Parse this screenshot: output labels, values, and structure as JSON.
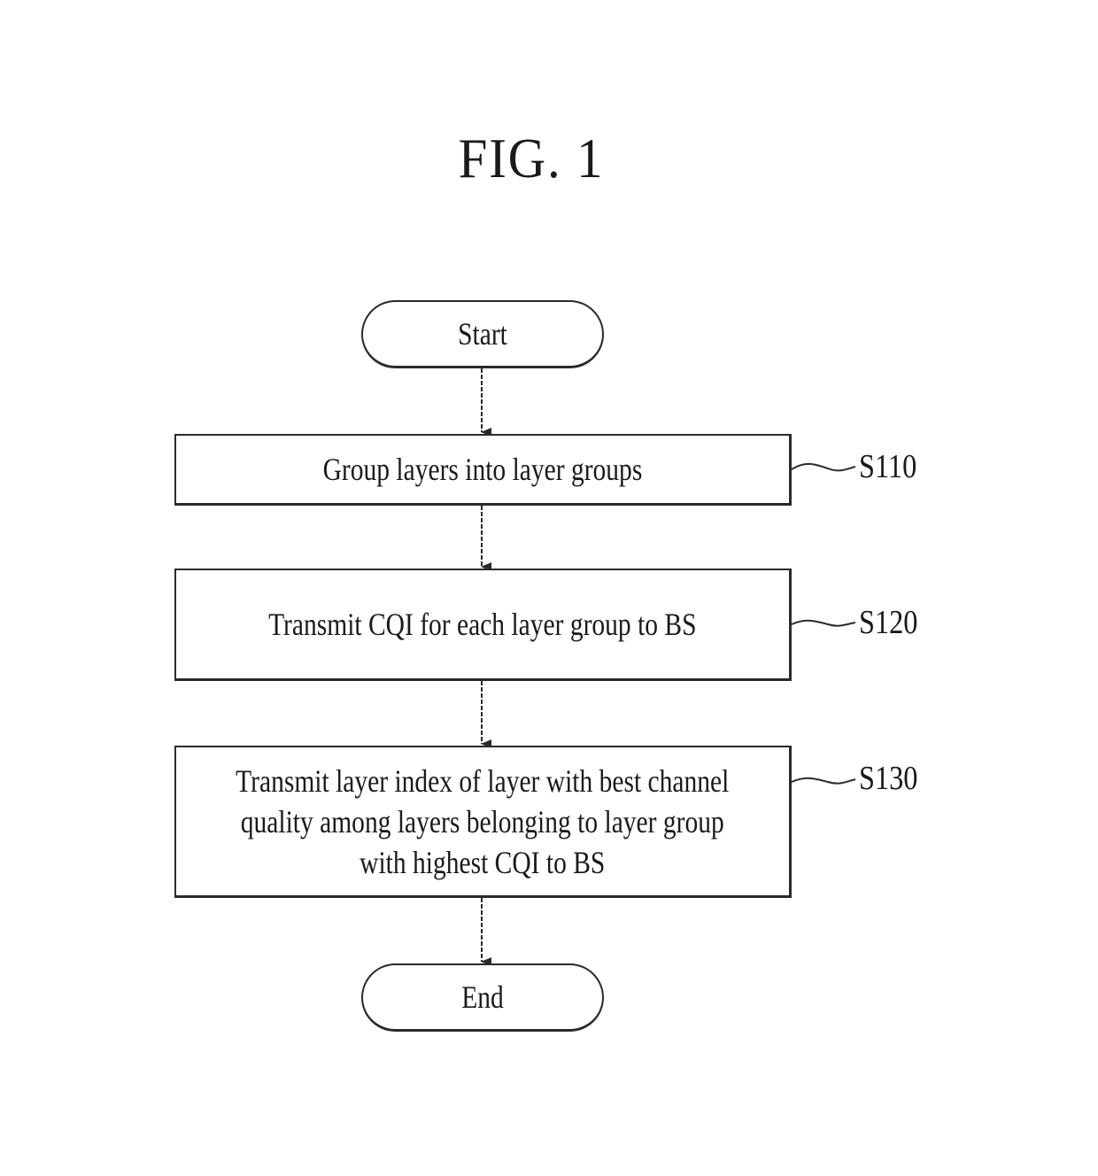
{
  "figure": {
    "title": "FIG. 1"
  },
  "flowchart": {
    "start": {
      "label": "Start"
    },
    "steps": [
      {
        "id": "S110",
        "label": "Group layers into layer groups"
      },
      {
        "id": "S120",
        "label": "Transmit CQI for each layer group to BS"
      },
      {
        "id": "S130",
        "label": "Transmit layer index of layer with best channel\nquality among layers belonging to layer group\nwith highest CQI to BS"
      }
    ],
    "end": {
      "label": "End"
    }
  }
}
